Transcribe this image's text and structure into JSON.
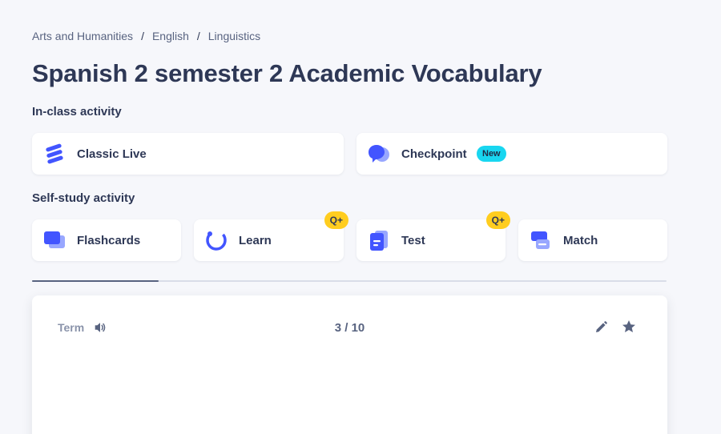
{
  "breadcrumb": {
    "items": [
      "Arts and Humanities",
      "English",
      "Linguistics"
    ],
    "separator": "/"
  },
  "title": "Spanish 2 semester 2 Academic Vocabulary",
  "in_class": {
    "heading": "In-class activity",
    "classic_live": "Classic Live",
    "checkpoint": "Checkpoint",
    "new_badge": "New"
  },
  "self_study": {
    "heading": "Self-study activity",
    "flashcards": "Flashcards",
    "learn": "Learn",
    "test": "Test",
    "match": "Match",
    "qplus_badge": "Q+"
  },
  "progress": {
    "current": 3,
    "total": 10,
    "fraction": 0.2
  },
  "flashcard": {
    "side_label": "Term",
    "counter": "3 / 10"
  },
  "colors": {
    "accent_blue": "#4255ff",
    "badge_new": "#18d6f0",
    "badge_qplus": "#ffcd1f",
    "text_dark": "#2e3856",
    "text_muted": "#586380"
  },
  "icons": {
    "classic_live": "classic-live-icon",
    "checkpoint": "checkpoint-icon",
    "flashcards": "flashcards-icon",
    "learn": "learn-icon",
    "test": "test-icon",
    "match": "match-icon",
    "audio": "speaker-icon",
    "edit": "pencil-icon",
    "star": "star-icon"
  }
}
